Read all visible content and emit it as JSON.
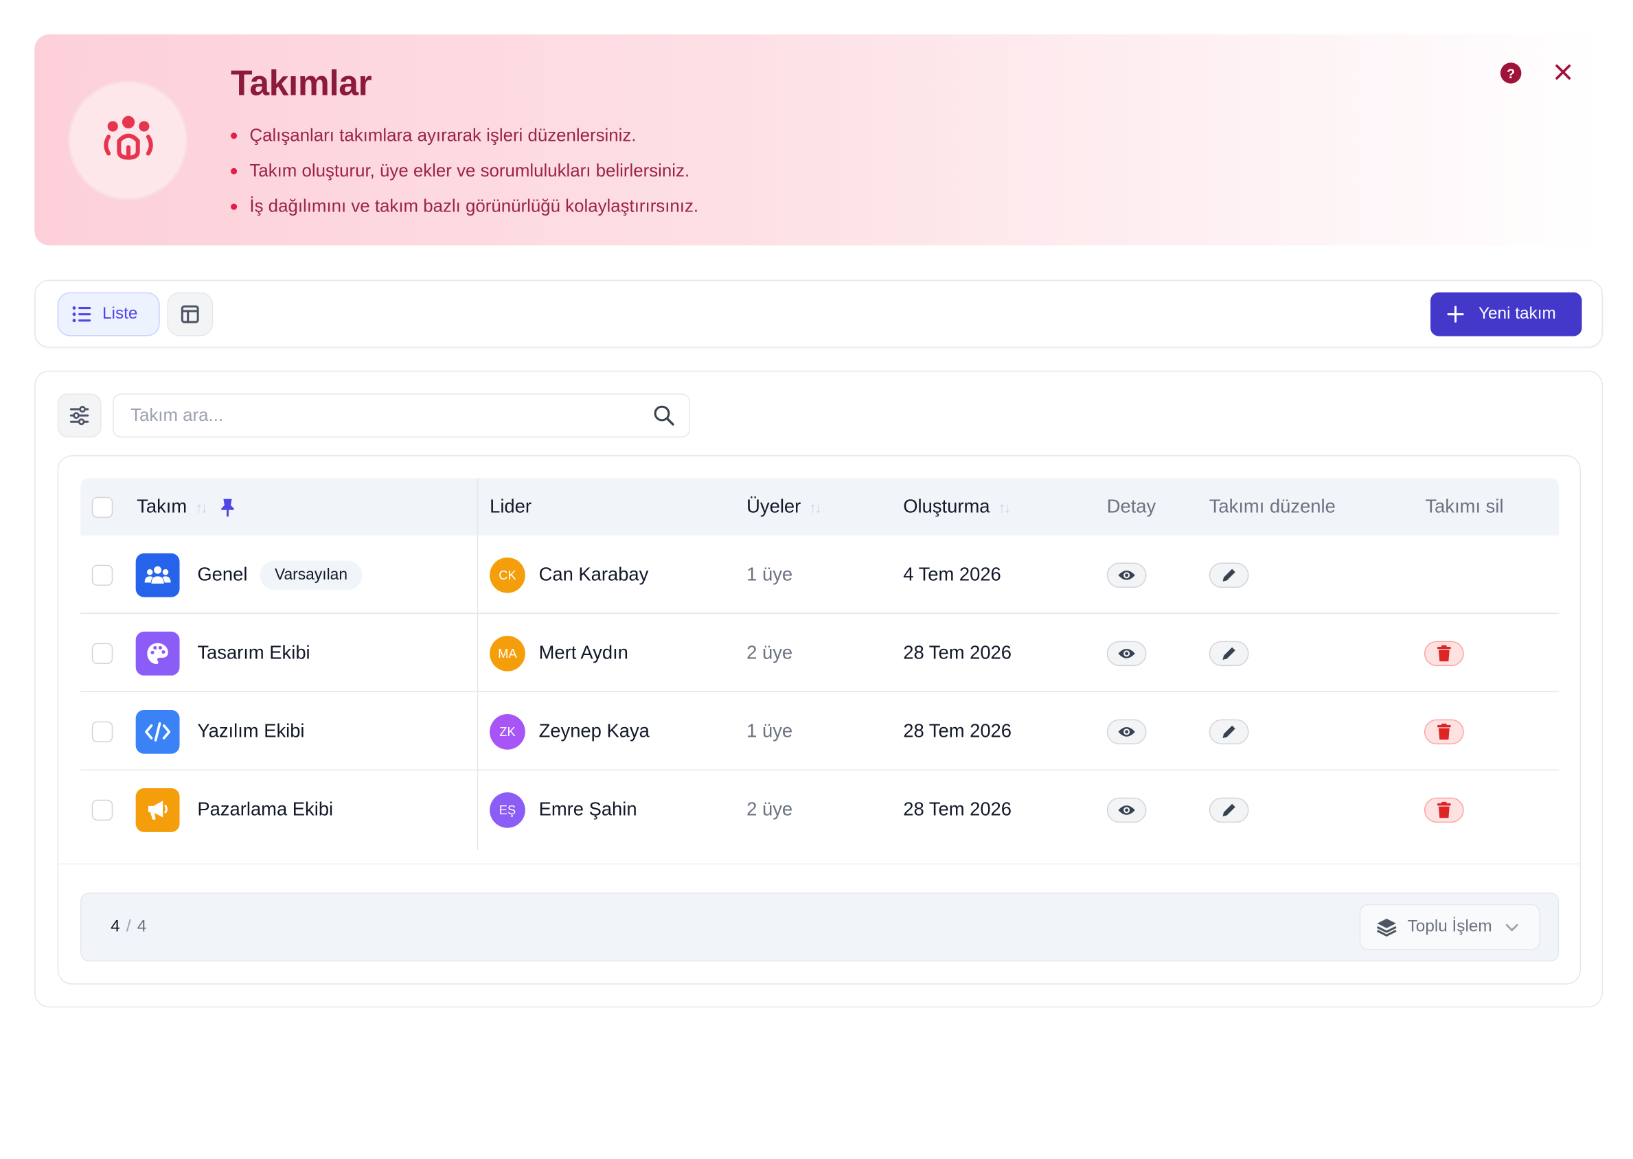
{
  "banner": {
    "title": "Takımlar",
    "bullets": [
      "Çalışanları takımlara ayırarak işleri düzenlersiniz.",
      "Takım oluşturur, üye ekler ve sorumlulukları belirlersiniz.",
      "İş dağılımını ve takım bazlı görünürlüğü kolaylaştırırsınız."
    ],
    "icon": "team-icon",
    "help_label": "?"
  },
  "toolbar": {
    "list_view_label": "Liste",
    "new_team_label": "Yeni takım"
  },
  "search": {
    "placeholder": "Takım ara..."
  },
  "table": {
    "columns": {
      "team": "Takım",
      "leader": "Lider",
      "members": "Üyeler",
      "created": "Oluşturma",
      "detail": "Detay",
      "edit": "Takımı düzenle",
      "delete": "Takımı sil"
    },
    "rows": [
      {
        "name": "Genel",
        "badge": "Varsayılan",
        "icon": "users-icon",
        "icon_color": "#2563eb",
        "leader_initials": "CK",
        "leader": "Can Karabay",
        "avatar_color": "#f59e0b",
        "members": "1 üye",
        "created": "4 Tem 2026",
        "deletable": false
      },
      {
        "name": "Tasarım Ekibi",
        "icon": "palette-icon",
        "icon_color": "#8b5cf6",
        "leader_initials": "MA",
        "leader": "Mert Aydın",
        "avatar_color": "#f59e0b",
        "members": "2 üye",
        "created": "28 Tem 2026",
        "deletable": true
      },
      {
        "name": "Yazılım Ekibi",
        "icon": "code-icon",
        "icon_color": "#3b82f6",
        "leader_initials": "ZK",
        "leader": "Zeynep Kaya",
        "avatar_color": "#a855f7",
        "members": "1 üye",
        "created": "28 Tem 2026",
        "deletable": true
      },
      {
        "name": "Pazarlama Ekibi",
        "icon": "megaphone-icon",
        "icon_color": "#f59e0b",
        "leader_initials": "EŞ",
        "leader": "Emre Şahin",
        "avatar_color": "#8b5cf6",
        "members": "2 üye",
        "created": "28 Tem 2026",
        "deletable": true
      }
    ]
  },
  "footer": {
    "shown": "4",
    "separator": "/",
    "total": "4",
    "bulk_action_label": "Toplu İşlem"
  },
  "colors": {
    "primary": "#4338ca",
    "banner_title": "#8b1a3c",
    "danger": "#dc2626"
  }
}
